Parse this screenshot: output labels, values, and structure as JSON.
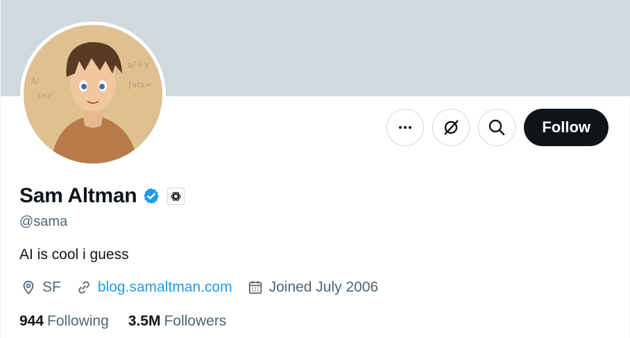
{
  "profile": {
    "display_name": "Sam Altman",
    "handle": "@sama",
    "bio": "AI is cool i guess",
    "location": "SF",
    "website": "blog.samaltman.com",
    "joined": "Joined July 2006"
  },
  "stats": {
    "following_count": "944",
    "following_label": "Following",
    "followers_count": "3.5M",
    "followers_label": "Followers"
  },
  "actions": {
    "follow_label": "Follow"
  },
  "colors": {
    "banner": "#cfd9de",
    "link": "#1d9bf0",
    "verified": "#1d9bf0",
    "follow_bg": "#0f1419",
    "muted_text": "#536471"
  },
  "icons": [
    "more-icon",
    "grok-icon",
    "search-icon",
    "verified-badge-icon",
    "openai-logo-icon",
    "location-icon",
    "link-icon",
    "calendar-icon"
  ]
}
